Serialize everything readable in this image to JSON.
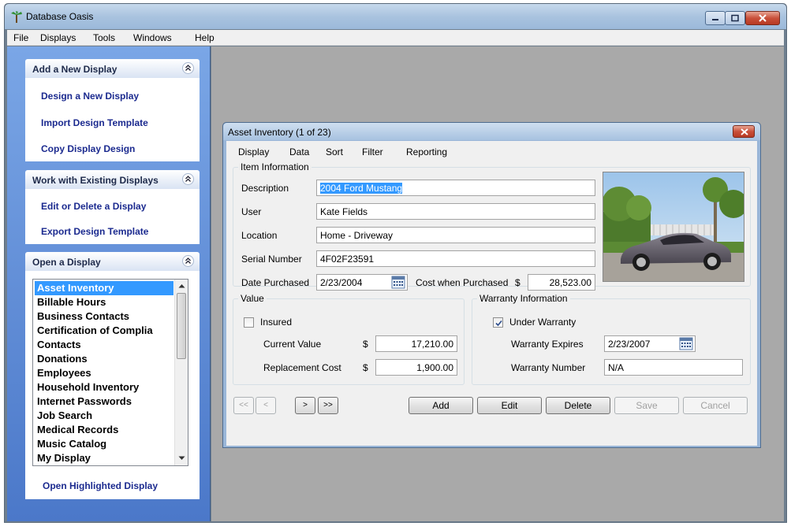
{
  "app": {
    "title": "Database Oasis",
    "menu": [
      "File",
      "Displays",
      "Tools",
      "Windows",
      "Help"
    ]
  },
  "sidebar": {
    "add_panel": {
      "header": "Add a New Display",
      "links": [
        "Design a New Display",
        "Import Design Template",
        "Copy Display Design"
      ]
    },
    "work_panel": {
      "header": "Work with Existing Displays",
      "links": [
        "Edit or Delete a Display",
        "Export Design Template"
      ]
    },
    "open_panel": {
      "header": "Open a Display",
      "items": [
        "Asset Inventory",
        "Billable Hours",
        "Business Contacts",
        "Certification of Complia",
        "Contacts",
        "Donations",
        "Employees",
        "Household Inventory",
        "Internet Passwords",
        "Job Search",
        "Medical Records",
        "Music Catalog",
        "My Display"
      ],
      "selected_index": 0,
      "open_link": "Open Highlighted Display"
    }
  },
  "child": {
    "title": "Asset Inventory  (1 of 23)",
    "menu": [
      "Display",
      "Data",
      "Sort",
      "Filter",
      "Reporting"
    ],
    "item_info": {
      "legend": "Item Information",
      "description_label": "Description",
      "description_value": "2004 Ford Mustang",
      "user_label": "User",
      "user_value": "Kate Fields",
      "location_label": "Location",
      "location_value": "Home - Driveway",
      "serial_label": "Serial Number",
      "serial_value": "4F02F23591",
      "date_label": "Date Purchased",
      "date_value": "2/23/2004",
      "cost_label": "Cost when Purchased",
      "cost_currency": "$",
      "cost_value": "28,523.00"
    },
    "value": {
      "legend": "Value",
      "insured_label": "Insured",
      "insured_checked": false,
      "current_label": "Current Value",
      "current_currency": "$",
      "current_value": "17,210.00",
      "replacement_label": "Replacement Cost",
      "replacement_currency": "$",
      "replacement_value": "1,900.00"
    },
    "warranty": {
      "legend": "Warranty Information",
      "under_label": "Under Warranty",
      "under_checked": true,
      "expires_label": "Warranty Expires",
      "expires_value": "2/23/2007",
      "number_label": "Warranty Number",
      "number_value": "N/A"
    },
    "nav": {
      "first": "<<",
      "prev": "<",
      "next": ">",
      "last": ">>"
    },
    "actions": {
      "add": "Add",
      "edit": "Edit",
      "delete": "Delete",
      "save": "Save",
      "cancel": "Cancel"
    }
  }
}
